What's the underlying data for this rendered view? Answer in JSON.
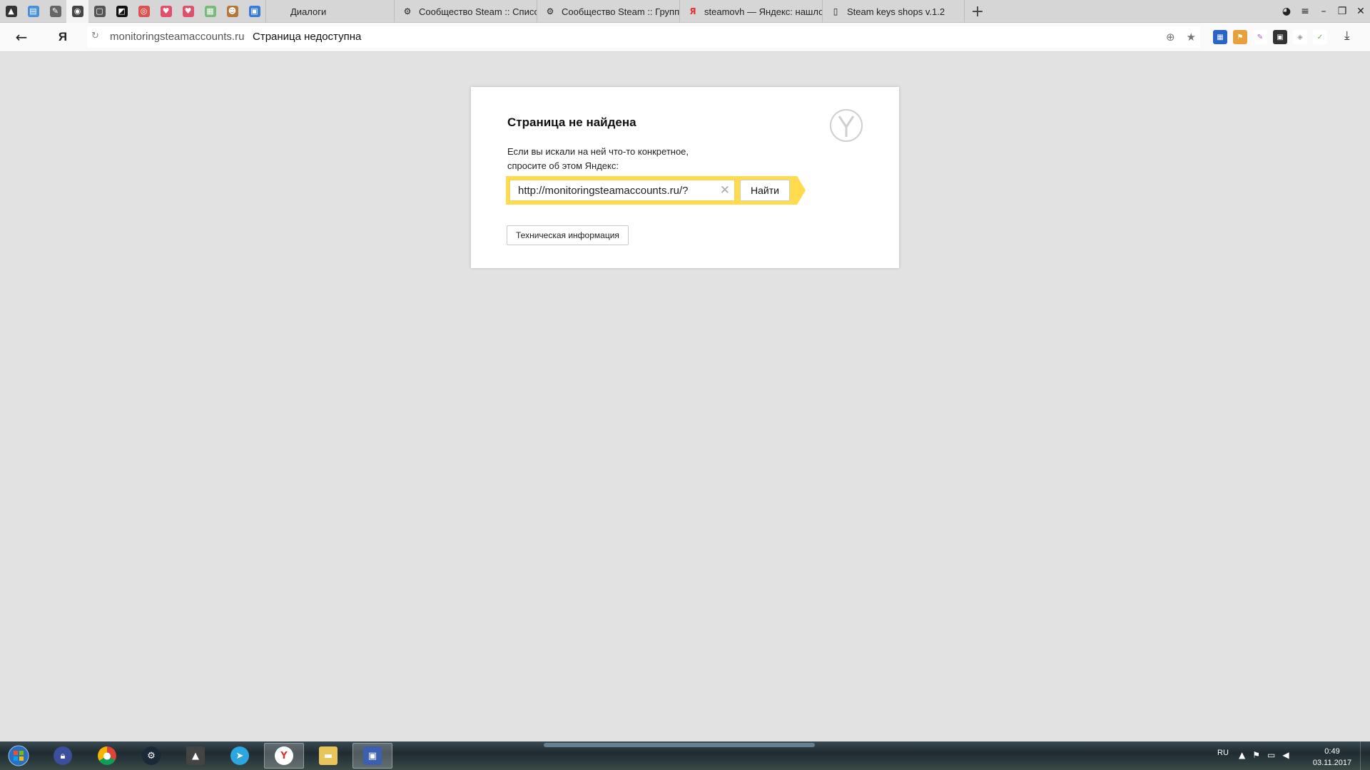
{
  "tabs": {
    "pinned": [
      {
        "name": "pinned-tab-1-icon",
        "glyph": "▲",
        "color": "#333333",
        "active": false
      },
      {
        "name": "pinned-tab-2-icon",
        "glyph": "▤",
        "color": "#4a8fd8",
        "active": false
      },
      {
        "name": "pinned-tab-3-icon",
        "glyph": "✎",
        "color": "#666666",
        "active": false
      },
      {
        "name": "pinned-tab-4-icon",
        "glyph": "◉",
        "color": "#444444",
        "active": true
      },
      {
        "name": "pinned-tab-5-icon",
        "glyph": "▢",
        "color": "#555555",
        "active": false
      },
      {
        "name": "pinned-tab-6-icon",
        "glyph": "◩",
        "color": "#111111",
        "active": false
      },
      {
        "name": "pinned-tab-7-icon",
        "glyph": "◎",
        "color": "#d9534f",
        "active": false
      },
      {
        "name": "pinned-tab-8-icon",
        "glyph": "♥",
        "color": "#e0506a",
        "active": false
      },
      {
        "name": "pinned-tab-9-icon",
        "glyph": "♥",
        "color": "#e0506a",
        "active": false
      },
      {
        "name": "pinned-tab-10-icon",
        "glyph": "▦",
        "color": "#7cb87a",
        "active": false
      },
      {
        "name": "pinned-tab-11-icon",
        "glyph": "☻",
        "color": "#b5763c",
        "active": false
      },
      {
        "name": "pinned-tab-12-icon",
        "glyph": "▣",
        "color": "#3a7bd5",
        "active": false
      }
    ],
    "items": [
      {
        "label": "Диалоги"
      },
      {
        "label": "Сообщество Steam :: Списо"
      },
      {
        "label": "Сообщество Steam :: Групп"
      },
      {
        "label": "steamovh — Яндекс: нашло"
      },
      {
        "label": "Steam keys shops v.1.2"
      }
    ],
    "new_tab_glyph": "+"
  },
  "address_bar": {
    "logo": "Я",
    "host": "monitoringsteamaccounts.ru",
    "title": "Страница недоступна"
  },
  "error": {
    "heading": "Страница не найдена",
    "desc_line1": "Если вы искали на ней что-то конкретное,",
    "desc_line2": "спросите об этом Яндекс:",
    "search_value": "http://monitoringsteamaccounts.ru/?",
    "search_button": "Найти",
    "tech_button": "Техническая информация",
    "accent": "#ffdb4d"
  },
  "taskbar": {
    "lang": "RU",
    "time": "0:49",
    "date": "03.11.2017"
  }
}
